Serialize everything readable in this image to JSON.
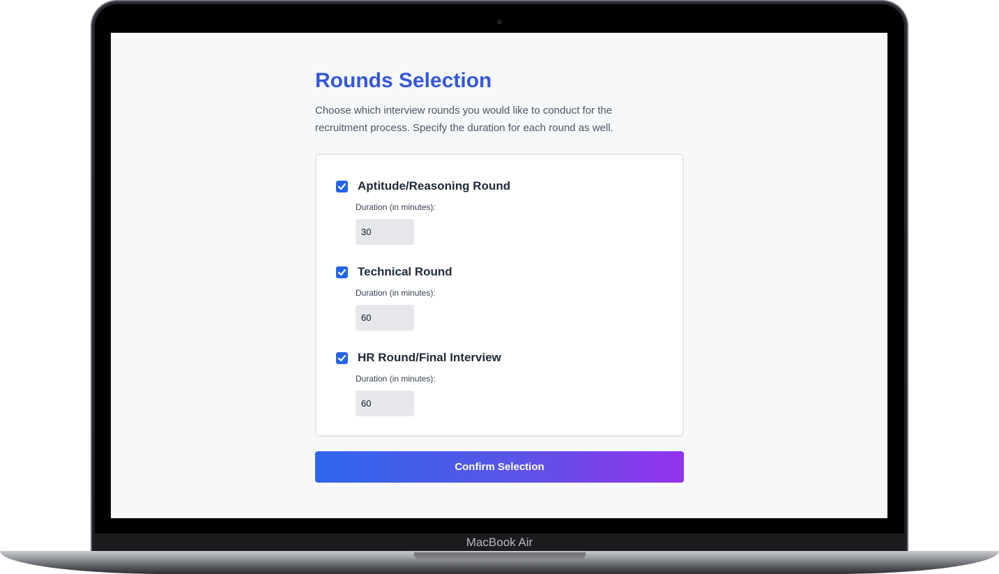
{
  "device": {
    "brand_label": "MacBook Air"
  },
  "page": {
    "title": "Rounds Selection",
    "description": "Choose which interview rounds you would like to conduct for the recruitment process. Specify the duration for each round as well."
  },
  "rounds": [
    {
      "label": "Aptitude/Reasoning Round",
      "checked": true,
      "duration_label": "Duration (in minutes):",
      "duration": "30"
    },
    {
      "label": "Technical Round",
      "checked": true,
      "duration_label": "Duration (in minutes):",
      "duration": "60"
    },
    {
      "label": "HR Round/Final Interview",
      "checked": true,
      "duration_label": "Duration (in minutes):",
      "duration": "60"
    }
  ],
  "actions": {
    "confirm_label": "Confirm Selection"
  },
  "colors": {
    "title": "#3457dc",
    "checkbox": "#2563eb",
    "button_gradient_start": "#2f66ea",
    "button_gradient_end": "#9333ea"
  }
}
